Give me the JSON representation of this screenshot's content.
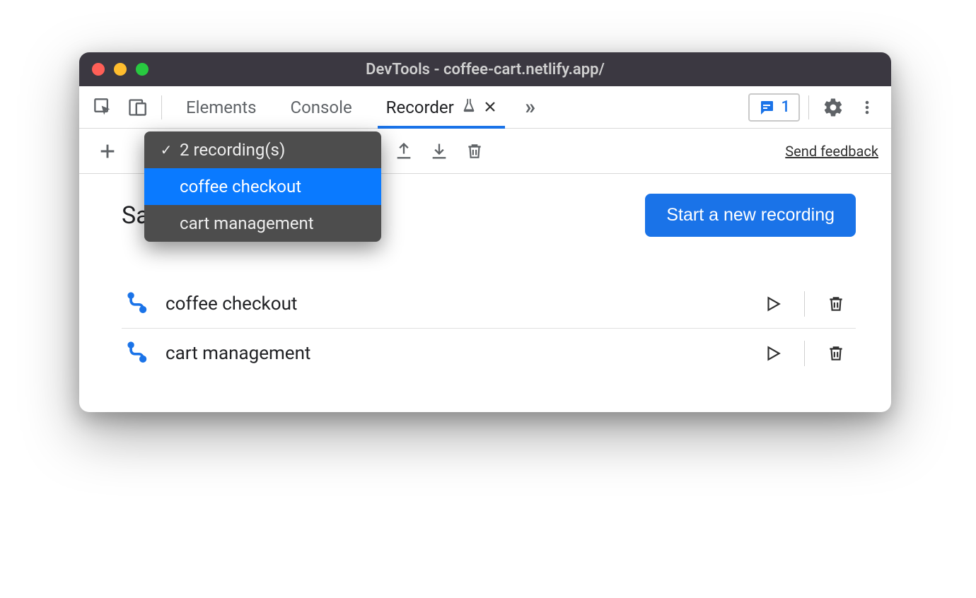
{
  "window": {
    "title": "DevTools - coffee-cart.netlify.app/"
  },
  "tabs": {
    "elements": "Elements",
    "console": "Console",
    "recorder": "Recorder"
  },
  "issues": {
    "count": "1"
  },
  "toolbar": {
    "feedback": "Send feedback"
  },
  "dropdown": {
    "summary": "2 recording(s)",
    "items": [
      "coffee checkout",
      "cart management"
    ]
  },
  "content": {
    "headline": "Saved recordings",
    "start_button": "Start a new recording"
  },
  "recordings": [
    {
      "name": "coffee checkout"
    },
    {
      "name": "cart management"
    }
  ]
}
